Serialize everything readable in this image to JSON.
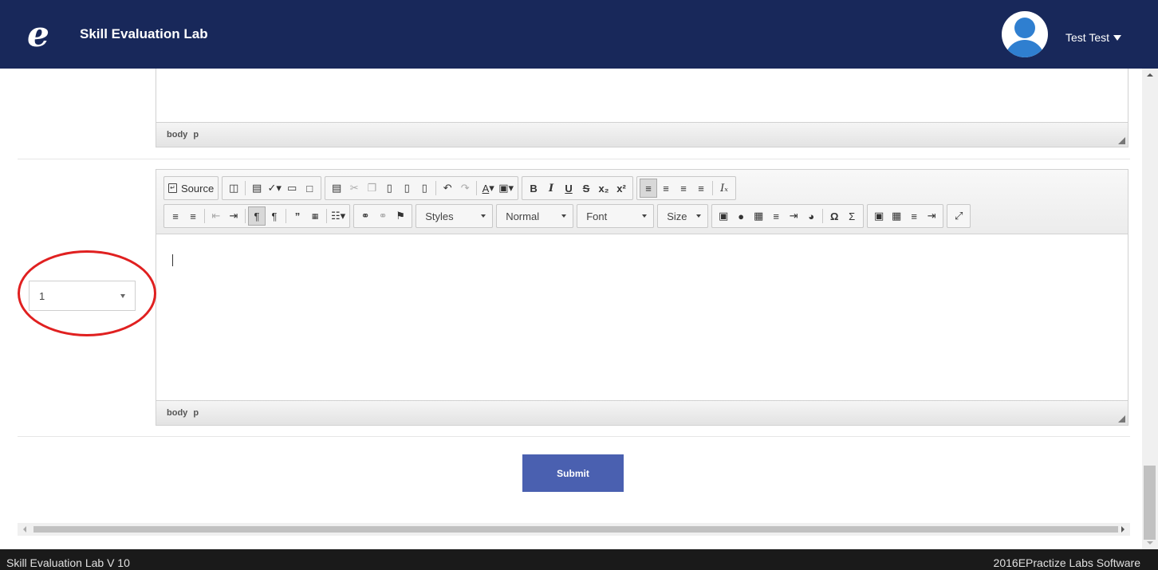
{
  "header": {
    "logo_glyph": "e",
    "app_title": "Skill Evaluation Lab",
    "user_name": "Test Test"
  },
  "editor_top": {
    "path": "body p"
  },
  "editor_main": {
    "source_label": "Source",
    "combos": {
      "styles": "Styles",
      "format": "Normal",
      "font": "Font",
      "size": "Size"
    },
    "path": "body p",
    "toolbar_icons_row1": [
      "preview-icon",
      "templates-icon",
      "spellcheck-icon",
      "save-icon",
      "new-page-icon",
      "document-icon",
      "cut-icon",
      "copy-icon",
      "paste-icon",
      "paste-text-icon",
      "paste-word-icon",
      "undo-icon",
      "redo-icon",
      "text-color-icon",
      "bg-color-icon",
      "bold-icon",
      "italic-icon",
      "underline-icon",
      "strike-icon",
      "subscript-icon",
      "superscript-icon",
      "align-left-icon",
      "align-center-icon",
      "align-right-icon",
      "justify-icon",
      "remove-format-icon"
    ],
    "toolbar_icons_row2": [
      "numbered-list-icon",
      "bulleted-list-icon",
      "outdent-icon",
      "indent-icon",
      "ltr-icon",
      "rtl-icon",
      "blockquote-icon",
      "div-icon",
      "language-icon",
      "link-icon",
      "unlink-icon",
      "anchor-icon",
      "image-icon",
      "flash-icon",
      "table-icon",
      "horizontal-rule-icon",
      "smiley-icon",
      "special-char-icon",
      "omega-icon",
      "sigma-icon",
      "image2-icon",
      "table2-icon",
      "hr2-icon",
      "pagebreak-icon",
      "maximize-icon"
    ]
  },
  "row_select": {
    "value": "1"
  },
  "actions": {
    "submit_label": "Submit"
  },
  "footer": {
    "left": "Skill Evaluation Lab V 10",
    "right": "2016EPractize Labs Software"
  },
  "colors": {
    "header_bg": "#18285a",
    "submit_bg": "#4a60b0",
    "annotation": "#e02020",
    "footer_bg": "#1a1a1a"
  }
}
